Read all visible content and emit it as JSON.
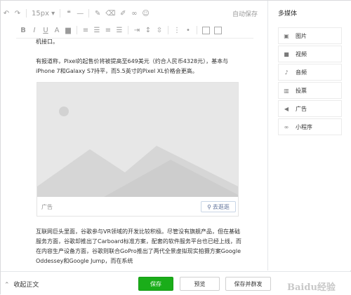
{
  "toolbar": {
    "font_size": "15px",
    "autosave": "自动保存",
    "bold": "B",
    "italic": "I",
    "underline": "U",
    "font_color": "A"
  },
  "content": {
    "lead_fragment": "机接口。",
    "paragraph1": "有报道称，Pixel的起售价将被提高至649美元（约合人民币4328元），基本与iPhone 7和Galaxy S7持平，而5.5英寸的Pixel XL价格会更高。",
    "image_caption": "广告",
    "goto_link": "去逛逛",
    "paragraph2": "互联网巨头里面，谷歌参与VR领域的开发比较积极。尽管没有旗舰产品，但在基础服务方面，谷歌却推出了Carboard标准方案，配套的软件服务平台也已经上线，而在内容生产设备方面，谷歌则联合GoPro推出了两代全景虚拟现实拍摄方案Google Oddessey和Google Jump，而在系统"
  },
  "sidebar": {
    "title": "多媒体",
    "items": [
      {
        "label": "图片",
        "icon": "image-icon"
      },
      {
        "label": "视频",
        "icon": "video-icon"
      },
      {
        "label": "音频",
        "icon": "microphone-icon"
      },
      {
        "label": "投票",
        "icon": "poll-icon"
      },
      {
        "label": "广告",
        "icon": "megaphone-icon"
      },
      {
        "label": "小程序",
        "icon": "link-icon"
      }
    ]
  },
  "footer": {
    "collapse": "收起正文",
    "save": "保存",
    "preview": "预览",
    "publish": "保存并群发"
  },
  "watermark": "Baidu经验",
  "colors": {
    "save_button": "#1aad19",
    "link": "#576b95"
  }
}
